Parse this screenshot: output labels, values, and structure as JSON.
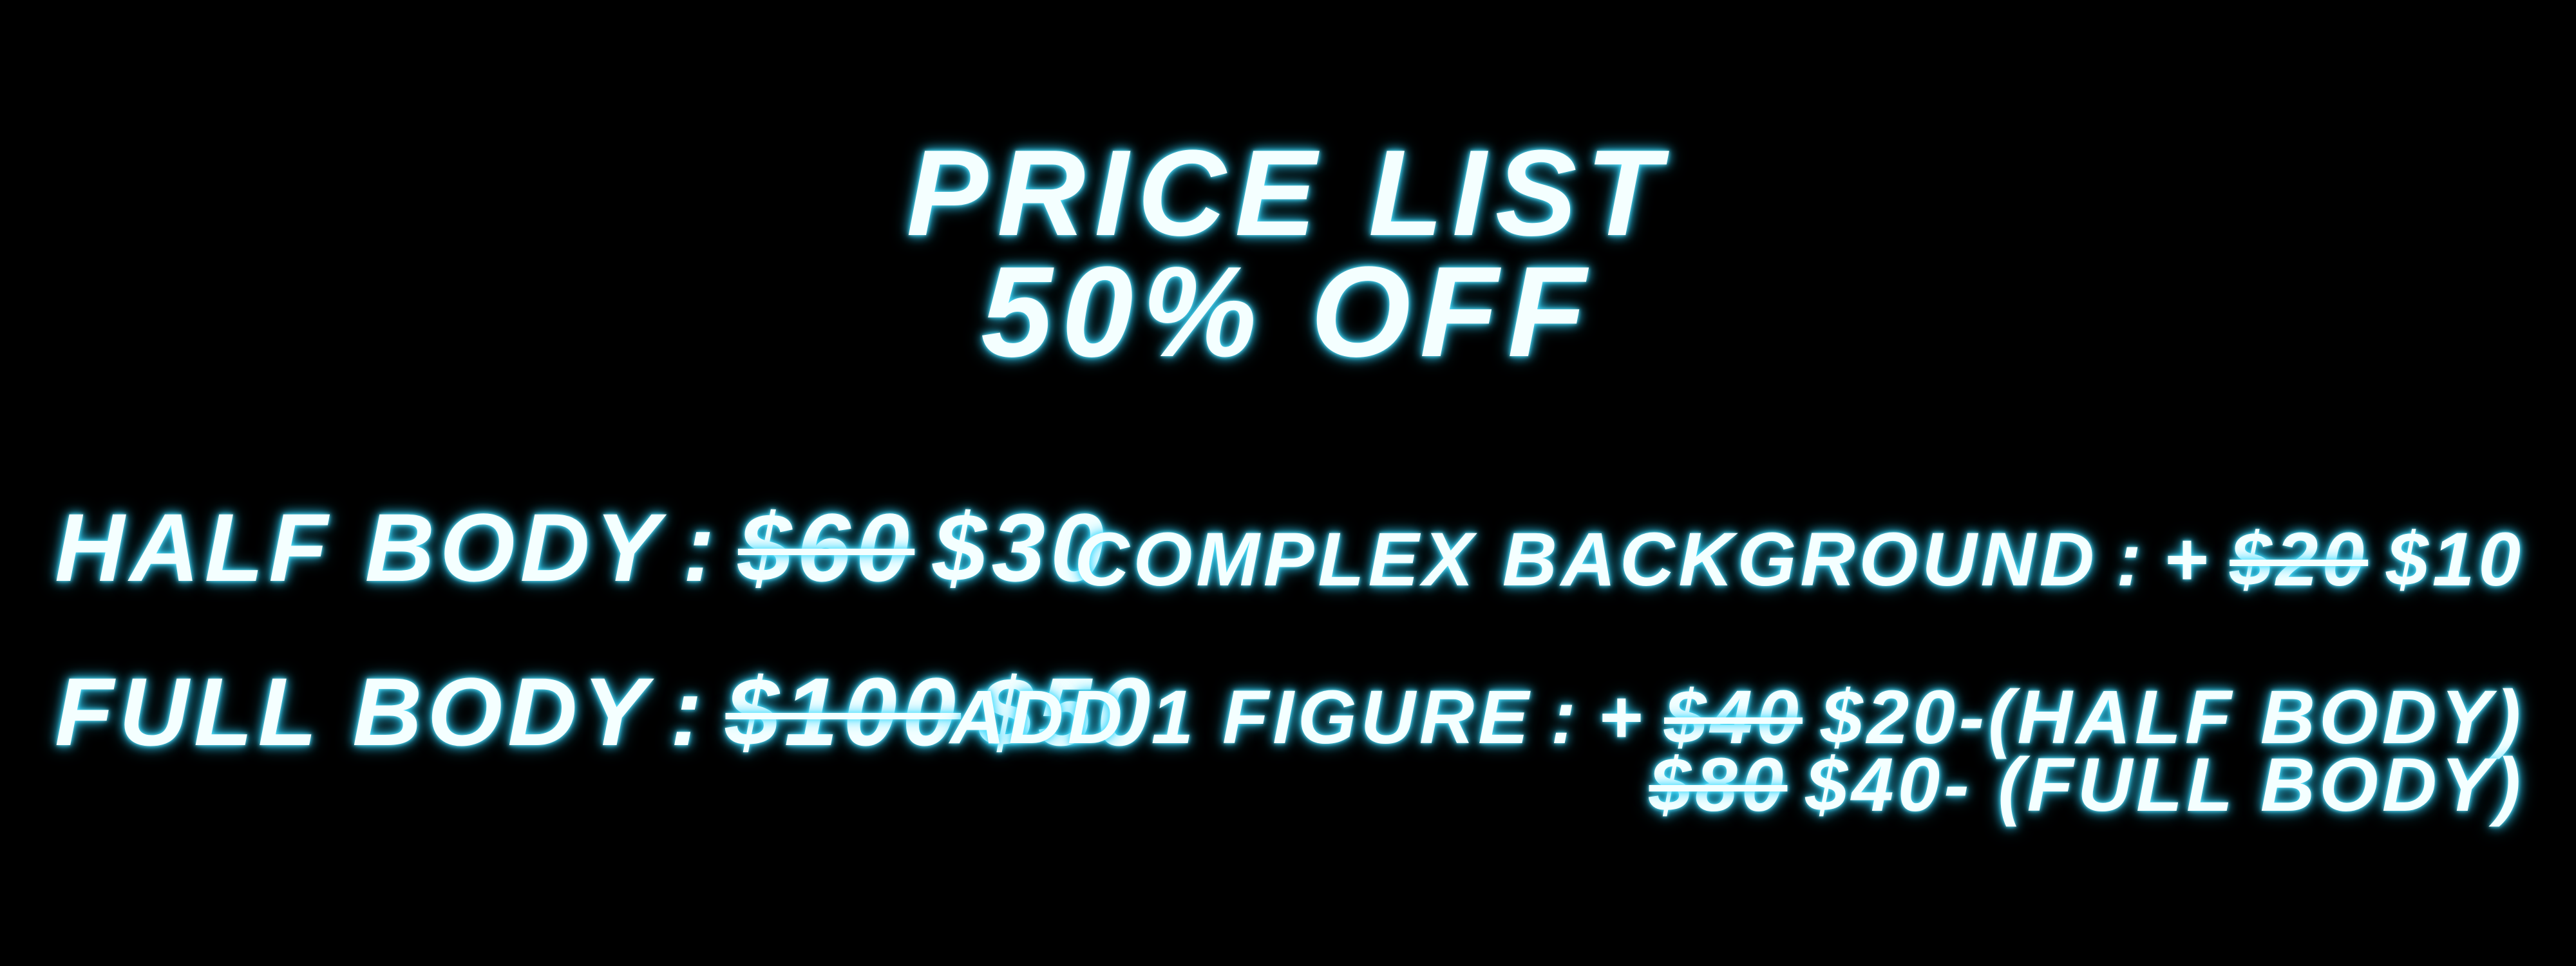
{
  "title": "PRICE LIST",
  "subtitle": "50% OFF",
  "left_items": [
    {
      "label": "HALF BODY",
      "separator": ":",
      "old_price": "$60",
      "new_price": "$30"
    },
    {
      "label": "FULL BODY",
      "separator": ":",
      "old_price": "$100",
      "new_price": "$50"
    }
  ],
  "right_items": [
    {
      "label": "COMPLEX BACKGROUND",
      "separator": ":",
      "prefix": "+",
      "old_price": "$20",
      "new_price": "$10"
    },
    {
      "label": "ADD 1 FIGURE",
      "separator": ":",
      "prefix": "+",
      "old_price": "$40",
      "new_price": "$20-(HALF BODY)"
    }
  ],
  "add_figure_line2": {
    "old_price": "$80",
    "new_price": "$40- (FULL BODY)"
  },
  "colors": {
    "background": "#000000",
    "text": "#f4ffff",
    "glow": "#2fd4ff"
  }
}
